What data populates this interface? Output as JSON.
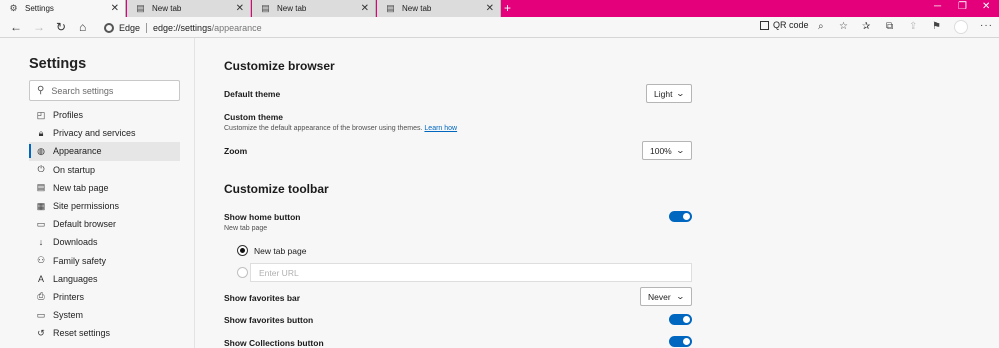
{
  "tabs": [
    {
      "label": "Settings",
      "icon": "gear-icon",
      "active": true
    },
    {
      "label": "New tab",
      "icon": "page-icon",
      "active": false
    },
    {
      "label": "New tab",
      "icon": "page-icon",
      "active": false
    },
    {
      "label": "New tab",
      "icon": "page-icon",
      "active": false
    }
  ],
  "address": {
    "host_label": "Edge",
    "url_scheme_host": "edge://settings",
    "url_path": "/appearance",
    "qr_label": "QR code"
  },
  "colors": {
    "titlebar": "#e3007a",
    "accent": "#0067c0"
  },
  "sidebar": {
    "title": "Settings",
    "search_placeholder": "Search settings",
    "items": [
      {
        "label": "Profiles",
        "icon": "profile-icon"
      },
      {
        "label": "Privacy and services",
        "icon": "lock-icon"
      },
      {
        "label": "Appearance",
        "icon": "palette-icon",
        "active": true
      },
      {
        "label": "On startup",
        "icon": "power-icon"
      },
      {
        "label": "New tab page",
        "icon": "newtab-icon"
      },
      {
        "label": "Site permissions",
        "icon": "site-permissions-icon"
      },
      {
        "label": "Default browser",
        "icon": "browser-icon"
      },
      {
        "label": "Downloads",
        "icon": "download-icon"
      },
      {
        "label": "Family safety",
        "icon": "family-icon"
      },
      {
        "label": "Languages",
        "icon": "language-icon"
      },
      {
        "label": "Printers",
        "icon": "printer-icon"
      },
      {
        "label": "System",
        "icon": "system-icon"
      },
      {
        "label": "Reset settings",
        "icon": "reset-icon"
      }
    ]
  },
  "main": {
    "customize_browser": {
      "heading": "Customize browser",
      "default_theme_label": "Default theme",
      "default_theme_value": "Light",
      "custom_theme_label": "Custom theme",
      "custom_theme_desc": "Customize the default appearance of the browser using themes.",
      "learn_how": "Learn how",
      "zoom_label": "Zoom",
      "zoom_value": "100%"
    },
    "customize_toolbar": {
      "heading": "Customize toolbar",
      "show_home_label": "Show home button",
      "show_home_sub": "New tab page",
      "show_home_on": true,
      "radio_newtab_label": "New tab page",
      "url_placeholder": "Enter URL",
      "favorites_bar_label": "Show favorites bar",
      "favorites_bar_value": "Never",
      "favorites_button_label": "Show favorites button",
      "favorites_button_on": true,
      "collections_label": "Show Collections button",
      "collections_on": true
    }
  }
}
